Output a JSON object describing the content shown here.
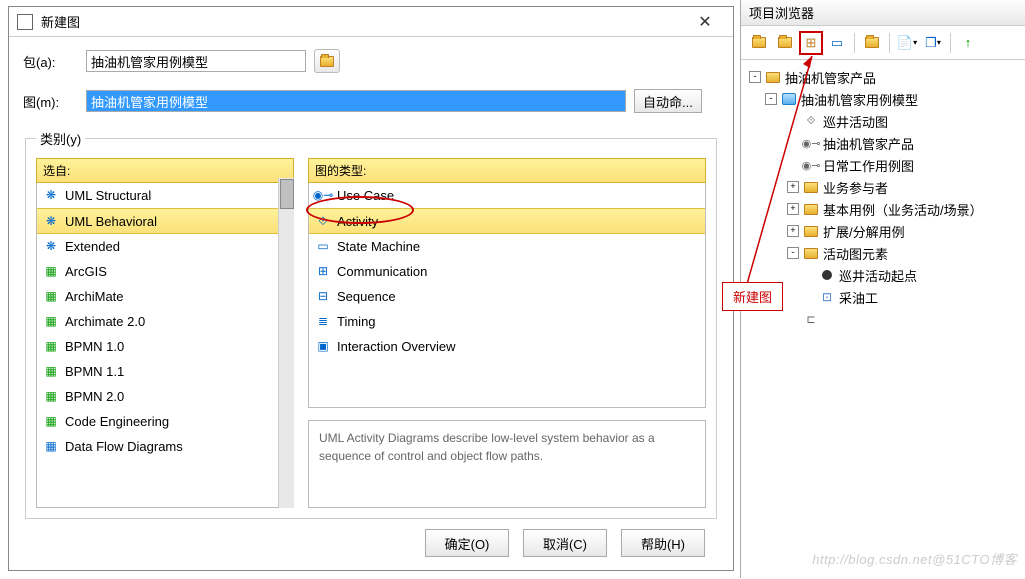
{
  "dialog": {
    "title": "新建图",
    "package_label": "包(a):",
    "package_value": "抽油机管家用例模型",
    "name_label": "图(m):",
    "name_value": "抽油机管家用例模型",
    "auto_name_btn": "自动命...",
    "category_legend": "类别(y)",
    "select_from_label": "选自:",
    "diagram_types_label": "图的类型:",
    "categories": [
      "UML Structural",
      "UML Behavioral",
      "Extended",
      "ArcGIS",
      "ArchiMate",
      "Archimate 2.0",
      "BPMN 1.0",
      "BPMN 1.1",
      "BPMN 2.0",
      "Code Engineering",
      "Data Flow Diagrams"
    ],
    "selected_category_index": 1,
    "diagram_types": [
      "Use Case",
      "Activity",
      "State Machine",
      "Communication",
      "Sequence",
      "Timing",
      "Interaction Overview"
    ],
    "selected_type_index": 1,
    "description": "UML Activity Diagrams describe low-level system behavior as a sequence of control and object flow paths.",
    "ok_btn": "确定(O)",
    "cancel_btn": "取消(C)",
    "help_btn": "帮助(H)"
  },
  "browser": {
    "title": "项目浏览器",
    "tree": {
      "root": "抽油机管家产品",
      "model": "抽油机管家用例模型",
      "items": [
        "巡井活动图",
        "抽油机管家产品",
        "日常工作用例图"
      ],
      "folders": [
        "业务参与者",
        "基本用例（业务活动/场景）",
        "扩展/分解用例",
        "活动图元素"
      ],
      "activity_elem": "巡井活动起点",
      "actor": "采油工"
    }
  },
  "annotation": {
    "label": "新建图"
  },
  "watermark": "http://blog.csdn.net@51CTO博客"
}
